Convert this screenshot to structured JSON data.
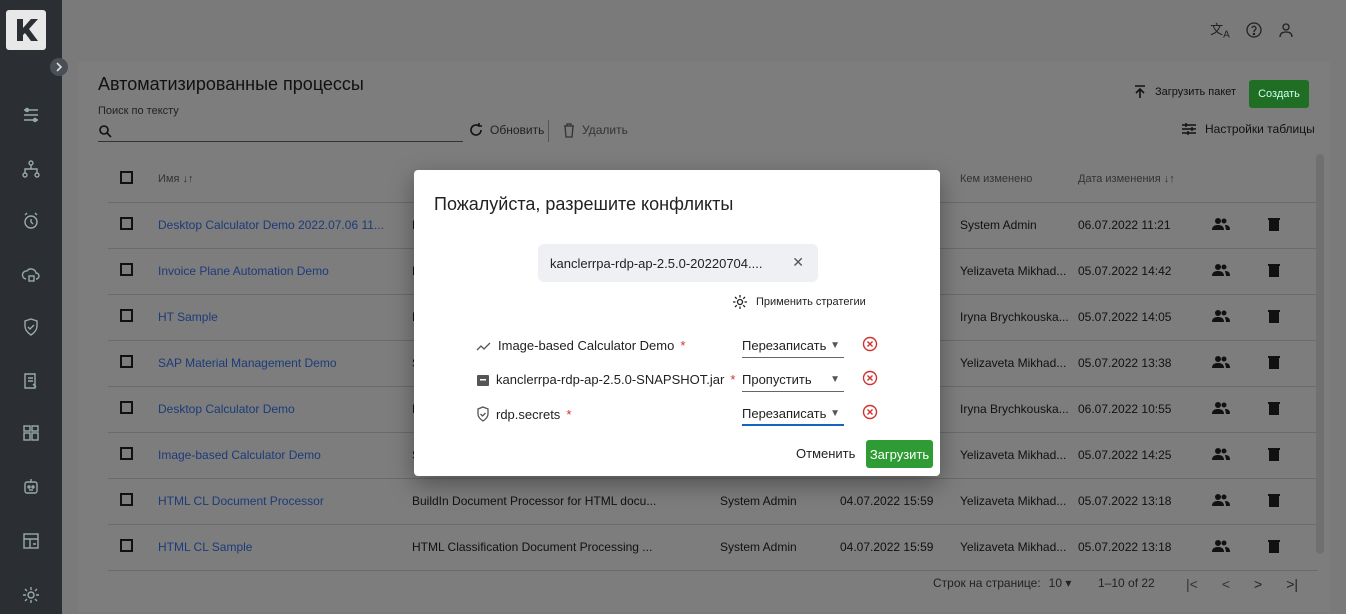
{
  "topbar": {
    "icons": [
      "translate-icon",
      "help-icon",
      "user-icon"
    ]
  },
  "sidebar": {
    "logo": "K",
    "icons": [
      "processes-icon",
      "hierarchy-icon",
      "schedule-icon",
      "cloud-lock-icon",
      "shield-icon",
      "document-list-icon",
      "grid-icon",
      "robot-icon",
      "dashboard-icon",
      "settings-icon"
    ]
  },
  "page": {
    "title": "Автоматизированные процессы",
    "search_label": "Поиск по тексту",
    "refresh_label": "Обновить",
    "delete_label": "Удалить",
    "upload_label": "Загрузить пакет",
    "create_label": "Создать",
    "table_settings_label": "Настройки таблицы"
  },
  "table": {
    "headers": {
      "name": "Имя ↓↑",
      "changed_by": "Кем изменено",
      "changed_date": "Дата изменения ↓↑"
    },
    "rows": [
      {
        "name": "Desktop Calculator Demo 2022.07.06 11...",
        "desc": "D",
        "author": "",
        "created": "",
        "changed_by": "System Admin",
        "changed": "06.07.2022 11:21"
      },
      {
        "name": "Invoice Plane Automation Demo",
        "desc": "E",
        "author": "",
        "created": "",
        "changed_by": "Yelizaveta Mikhad...",
        "changed": "05.07.2022 14:42"
      },
      {
        "name": "HT Sample",
        "desc": "H",
        "author": "",
        "created": "",
        "changed_by": "Iryna Brychkouska...",
        "changed": "05.07.2022 14:05"
      },
      {
        "name": "SAP Material Management Demo",
        "desc": "S",
        "author": "",
        "created": "",
        "changed_by": "Yelizaveta Mikhad...",
        "changed": "05.07.2022 13:38"
      },
      {
        "name": "Desktop Calculator Demo",
        "desc": "D",
        "author": "",
        "created": "",
        "changed_by": "Iryna Brychkouska...",
        "changed": "06.07.2022 10:55"
      },
      {
        "name": "Image-based Calculator Demo",
        "desc": "S",
        "author": "",
        "created": "",
        "changed_by": "Yelizaveta Mikhad...",
        "changed": "05.07.2022 14:25"
      },
      {
        "name": "HTML CL Document Processor",
        "desc": "BuildIn Document Processor for HTML docu...",
        "author": "System Admin",
        "created": "04.07.2022 15:59",
        "changed_by": "Yelizaveta Mikhad...",
        "changed": "05.07.2022 13:18"
      },
      {
        "name": "HTML CL Sample",
        "desc": "HTML Classification Document Processing ...",
        "author": "System Admin",
        "created": "04.07.2022 15:59",
        "changed_by": "Yelizaveta Mikhad...",
        "changed": "05.07.2022 13:18"
      }
    ]
  },
  "footer": {
    "rows_per_page_label": "Строк на странице:",
    "rows_per_page": "10",
    "range": "1–10 of 22"
  },
  "modal": {
    "title": "Пожалуйста, разрешите конфликты",
    "file_chip": "kanclerrpa-rdp-ap-2.5.0-20220704....",
    "apply_strategies": "Применить стратегии",
    "conflicts": [
      {
        "icon": "trend-icon",
        "name": "Image-based Calculator Demo",
        "required": "*",
        "strategy": "Перезаписать"
      },
      {
        "icon": "archive-icon",
        "name": "kanclerrpa-rdp-ap-2.5.0-SNAPSHOT.jar",
        "required": "*",
        "strategy": "Пропустить"
      },
      {
        "icon": "shield-check-icon",
        "name": "rdp.secrets",
        "required": "*",
        "strategy": "Перезаписать"
      }
    ],
    "cancel_label": "Отменить",
    "upload_label": "Загрузить"
  }
}
